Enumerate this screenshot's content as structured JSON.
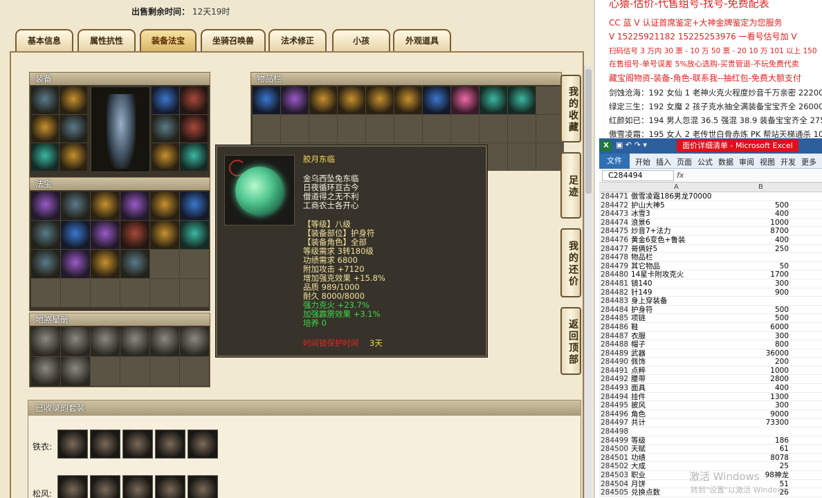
{
  "sell_time": {
    "label": "出售剩余时间：",
    "value": "12天19时"
  },
  "tabs": [
    "基本信息",
    "属性抗性",
    "装备法宝",
    "坐骑召唤兽",
    "法术修正",
    "小孩",
    "外观道具"
  ],
  "panels": {
    "equip": "装备",
    "fabao": "法宝",
    "inventory": "物品栏",
    "xingce": "地煞星册",
    "sets": "已收录的套装"
  },
  "side_buttons": [
    "我的收藏",
    "足迹",
    "我的还价",
    "返回顶部"
  ],
  "tooltip": {
    "name": "胶月东临",
    "poem": [
      "金乌西坠兔东临",
      "日夜循环亘古今",
      "僧道得之无不利",
      "工商农士各开心"
    ],
    "props": [
      "【等级】八级",
      "【装备部位】护身符",
      "【装备角色】全部",
      "等级需求 3转180级",
      "功绩需求 6800",
      "附加攻击 +7120",
      "增加强克效果 +15.8%",
      "品质 989/1000",
      "耐久 8000/8000"
    ],
    "green": [
      "强力克火 +23.7%",
      "加强霹雳效果 +3.1%",
      "培养 0"
    ],
    "protect_label": "时间锁保护时间",
    "protect_value": "3天"
  },
  "set_rows": [
    {
      "label": "铁衣:"
    },
    {
      "label": "松风:"
    }
  ],
  "right_texts": [
    {
      "t": "心猿-估价-代售组号-找号-免费配表",
      "c": "red"
    },
    {
      "t": "CC 蓝 V 认证首席鉴定+大神金牌鉴定为您服务",
      "c": "red"
    },
    {
      "t": "V 15225921182    15225253976 一看号估号加 V",
      "c": "red"
    },
    {
      "t": "扫码估号 3 万内 30 票 - 10 万 50 票 - 20 10 万 101 以上 150",
      "c": "red"
    },
    {
      "t": "在售组号-单号误差 5%放心选购-买贵管退-不玩免费代卖",
      "c": "red"
    },
    {
      "t": "藏宝阁物资-装备-角色-联系我--抽红包-免费大额支付",
      "c": "red"
    },
    {
      "t": "剑蚀沧海：192 女仙 1 老神火克火程度炒音千万亲密 22200",
      "c": "blk"
    },
    {
      "t": "绿定三生：192 女魔 2 孩子克水抽全满装备宝宝齐全 26000",
      "c": "blk"
    },
    {
      "t": "红颜如已：194 男人忽混 36.5 强混 38.9 装备宝宝齐全 27500",
      "c": "blk"
    },
    {
      "t": "傲雪凌霜：195 女人 2 老传世白骨赤炼 PK 帮站天梯通杀 10W",
      "c": "blk"
    }
  ],
  "excel": {
    "title": "面价详细清单 - Microsoft Excel",
    "ribbon": [
      "文件",
      "开始",
      "插入",
      "页面",
      "公式",
      "数据",
      "审阅",
      "视图",
      "开发",
      "更多"
    ],
    "cell_ref": "C284494",
    "fx": "fx",
    "cols": [
      "A",
      "B"
    ],
    "rows": [
      [
        "284471",
        "傲雪凌霜186男龙70000",
        ""
      ],
      [
        "284472",
        "护山大神5",
        "500"
      ],
      [
        "284473",
        "冰雪3",
        "400"
      ],
      [
        "284474",
        "浪景6",
        "1000"
      ],
      [
        "284475",
        "炒音7+法力",
        "8700"
      ],
      [
        "284476",
        "黄金6变色+鲁装",
        "400"
      ],
      [
        "284477",
        "哥俩好5",
        "250"
      ],
      [
        "284478",
        "物品栏",
        ""
      ],
      [
        "284479",
        "其它物品",
        "50"
      ],
      [
        "284480",
        "14星卡附攻克火",
        "1700"
      ],
      [
        "284481",
        "镜140",
        "300"
      ],
      [
        "284482",
        "针149",
        "900"
      ],
      [
        "284483",
        "身上穿装备",
        ""
      ],
      [
        "284484",
        "护身符",
        "500"
      ],
      [
        "284485",
        "项链",
        "500"
      ],
      [
        "284486",
        "鞋",
        "6000"
      ],
      [
        "284487",
        "衣服",
        "300"
      ],
      [
        "284488",
        "帽子",
        "800"
      ],
      [
        "284489",
        "武器",
        "36000"
      ],
      [
        "284490",
        "佩饰",
        "200"
      ],
      [
        "284491",
        "点粹",
        "1000"
      ],
      [
        "284492",
        "腰带",
        "2800"
      ],
      [
        "284493",
        "面具",
        "400"
      ],
      [
        "284494",
        "挂件",
        "1300"
      ],
      [
        "284495",
        "披风",
        "300"
      ],
      [
        "284496",
        "角色",
        "9000"
      ],
      [
        "284497",
        "共计",
        "73300"
      ],
      [
        "284498",
        "",
        ""
      ],
      [
        "284499",
        "等级",
        "186"
      ],
      [
        "284500",
        "天赋",
        "61"
      ],
      [
        "284501",
        "功绩",
        "8078"
      ],
      [
        "284502",
        "大成",
        "25"
      ],
      [
        "284503",
        "职业",
        "98神龙"
      ],
      [
        "284504",
        "月饼",
        "51"
      ],
      [
        "284505",
        "兑换点数",
        "26"
      ]
    ],
    "watermark": "激活 Windows",
    "watermark_sub": "转到\"设置\"以激活 Windows"
  }
}
